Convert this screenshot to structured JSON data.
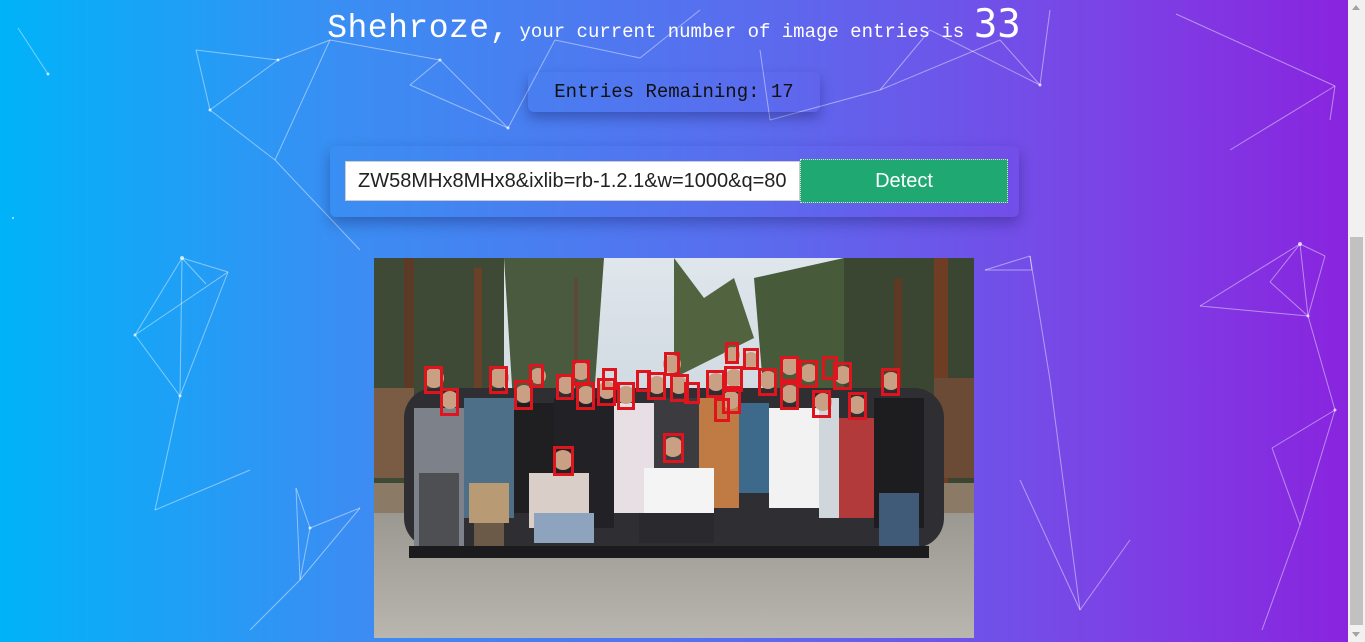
{
  "greeting": {
    "name": "Shehroze,",
    "text": "your current number of image entries is",
    "count": "33"
  },
  "remaining": {
    "text": "Entries Remaining: 17"
  },
  "form": {
    "input_value": "ZW58MHx8MHx8&ixlib=rb-1.2.1&w=1000&q=80",
    "button_label": "Detect"
  },
  "detection": {
    "face_count": 33,
    "box_color": "#e0141c"
  },
  "colors": {
    "gradient_start": "#00b3f9",
    "gradient_end": "#8a22de",
    "button": "#1fa872"
  }
}
